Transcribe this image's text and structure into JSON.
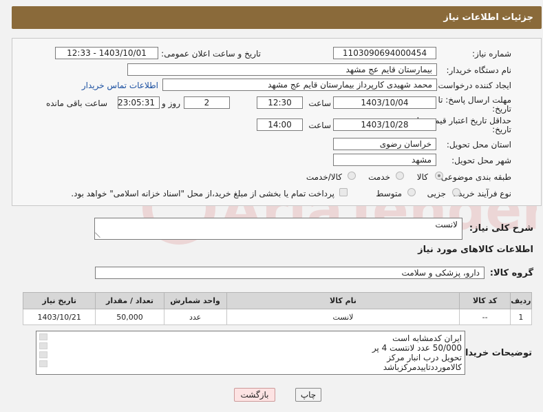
{
  "header": {
    "title": "جزئیات اطلاعات نیاز"
  },
  "fields": {
    "need_number_label": "شماره نیاز:",
    "need_number": "1103090694000454",
    "announce_label": "تاریخ و ساعت اعلان عمومی:",
    "announce_value": "1403/10/01 - 12:33",
    "buyer_org_label": "نام دستگاه خریدار:",
    "buyer_org": "بیمارستان قایم  عج  مشهد",
    "creator_label": "ایجاد کننده درخواست:",
    "creator": "محمد شهیدی کارپرداز بیمارستان قایم  عج  مشهد",
    "contact_link": "اطلاعات تماس خریدار",
    "reply_deadline_label_1": "مهلت ارسال پاسخ: تا",
    "reply_deadline_label_2": "تاریخ:",
    "reply_date": "1403/10/04",
    "time_label": "ساعت",
    "reply_time": "12:30",
    "days_value": "2",
    "days_label": "روز و",
    "remaining_time": "23:05:31",
    "remaining_label": "ساعت باقی مانده",
    "price_valid_label_1": "حداقل تاریخ اعتبار قیمت: تا",
    "price_valid_label_2": "تاریخ:",
    "price_valid_date": "1403/10/28",
    "price_valid_time": "14:00",
    "province_label": "استان محل تحویل:",
    "province": "خراسان رضوی",
    "city_label": "شهر محل تحویل:",
    "city": "مشهد",
    "category_label": "طبقه بندی موضوعی:",
    "category_options": [
      "کالا",
      "خدمت",
      "کالا/خدمت"
    ],
    "process_label": "نوع فرآیند خرید :",
    "process_options": [
      "جزیی",
      "متوسط"
    ],
    "payment_note": "پرداخت تمام یا بخشی از مبلغ خرید،از محل \"اسناد خزانه اسلامی\" خواهد بود."
  },
  "summary": {
    "label": "شرح کلی نیاز:",
    "value": "لانست"
  },
  "goods_section": {
    "title": "اطلاعات کالاهای مورد نیاز",
    "group_label": "گروه کالا:",
    "group_value": "دارو، پزشکی و سلامت"
  },
  "table": {
    "headers": [
      "ردیف",
      "کد کالا",
      "نام کالا",
      "واحد شمارش",
      "تعداد / مقدار",
      "تاریخ نیاز"
    ],
    "rows": [
      [
        "1",
        "--",
        "لانست",
        "عدد",
        "50,000",
        "1403/10/21"
      ]
    ]
  },
  "buyer_notes": {
    "label": "توضیحات خریدار:",
    "lines": [
      "ایران کدمشابه است",
      "50/000 عدد  لانتست 4 پر",
      "تحویل درب انبار مرکز",
      "کالامورددتاییدمرکزباشد"
    ]
  },
  "buttons": {
    "print": "چاپ",
    "back": "بازگشت"
  },
  "watermark": {
    "text": "AriaTender.neT"
  }
}
